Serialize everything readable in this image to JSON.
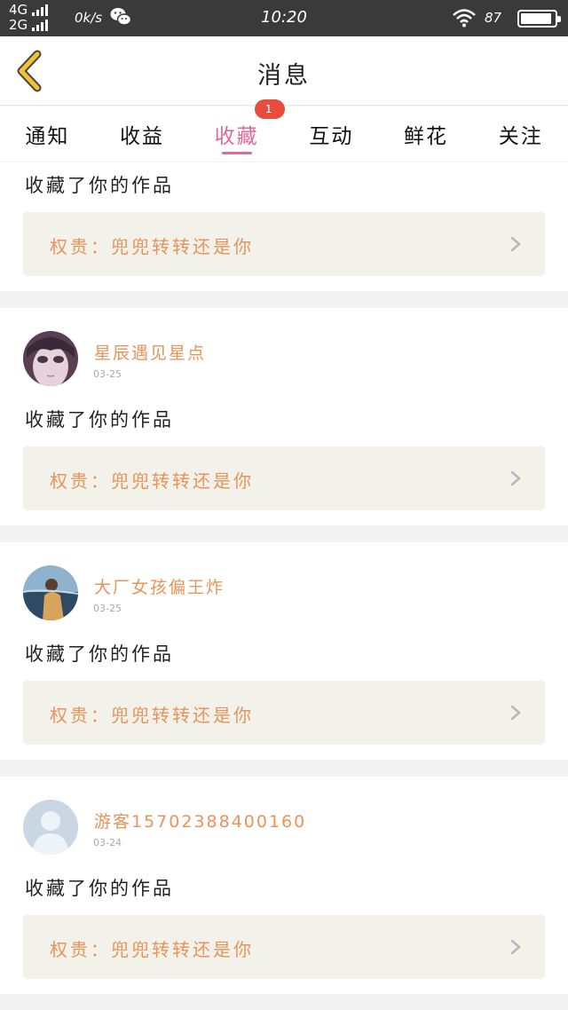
{
  "statusbar": {
    "network_top": "4G",
    "network_bottom": "2G",
    "speed": "0k/s",
    "time": "10:20",
    "battery": "87"
  },
  "header": {
    "title": "消息"
  },
  "tabs": [
    {
      "label": "通知"
    },
    {
      "label": "收益"
    },
    {
      "label": "收藏",
      "active": true,
      "badge": "1"
    },
    {
      "label": "互动"
    },
    {
      "label": "鲜花"
    },
    {
      "label": "关注"
    }
  ],
  "messages": [
    {
      "action": "收藏了你的作品",
      "work": "权贵：兜兜转转还是你"
    },
    {
      "user": "星辰遇见星点",
      "date": "03-25",
      "action": "收藏了你的作品",
      "work": "权贵：兜兜转转还是你"
    },
    {
      "user": "大厂女孩偏王炸",
      "date": "03-25",
      "action": "收藏了你的作品",
      "work": "权贵：兜兜转转还是你"
    },
    {
      "user": "游客15702388400160",
      "date": "03-24",
      "action": "收藏了你的作品",
      "work": "权贵：兜兜转转还是你"
    }
  ],
  "colors": {
    "accent_pink": "#e0689b",
    "username_orange": "#e8935a",
    "badge_red": "#e74c3c",
    "back_yellow": "#f2c230"
  }
}
